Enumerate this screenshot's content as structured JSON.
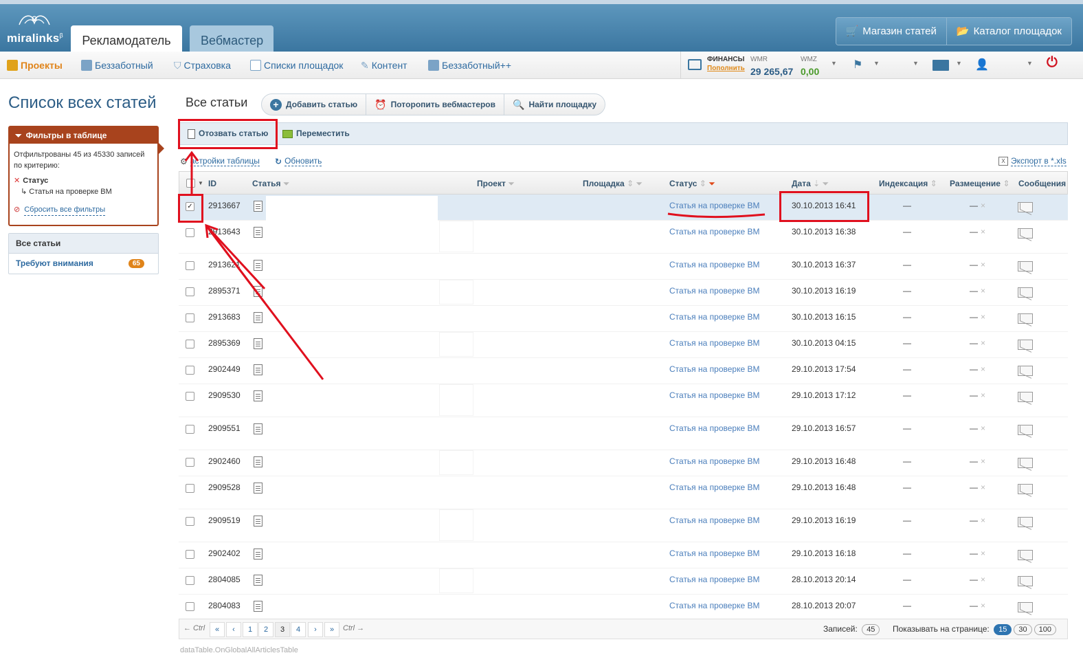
{
  "header": {
    "logo": "miralinks",
    "logo_sup": "β",
    "tabs": [
      {
        "label": "Рекламодатель",
        "active": true
      },
      {
        "label": "Вебмастер",
        "active": false
      }
    ],
    "shop_buttons": [
      "Магазин статей",
      "Каталог площадок"
    ]
  },
  "nav": {
    "items": [
      {
        "label": "Проекты",
        "icon": "projects-icon",
        "active": true
      },
      {
        "label": "Беззаботный",
        "icon": "users-icon"
      },
      {
        "label": "Страховка",
        "icon": "shield-icon"
      },
      {
        "label": "Списки площадок",
        "icon": "list-icon"
      },
      {
        "label": "Контент",
        "icon": "edit-icon"
      },
      {
        "label": "Беззаботный++",
        "icon": "users-icon"
      }
    ],
    "finance_label": "ФИНАНСЫ",
    "finance_link": "Пополнить",
    "wmr_label": "WMR",
    "wmr_value": "29 265,67",
    "wmz_label": "WMZ",
    "wmz_value": "0,00"
  },
  "sidebar": {
    "page_title": "Список всех статей",
    "filter_title": "Фильтры в таблице",
    "filter_summary": "Отфильтрованы 45 из 45330 записей по критерию:",
    "filter_criterion": "Статус",
    "filter_value": "Статья на проверке ВМ",
    "filter_reset": "Сбросить все фильтры",
    "list": [
      {
        "label": "Все статьи"
      },
      {
        "label": "Требуют внимания",
        "badge": "65"
      }
    ]
  },
  "main": {
    "section_title": "Все статьи",
    "actions": [
      "Добавить статью",
      "Потoропить вебмастеров",
      "Найти площадку"
    ],
    "toolbar": [
      "Отозвать статью",
      "Переместить"
    ],
    "settings_link": "астройки таблицы",
    "refresh_link": "Обновить",
    "export_link": "Экспорт в *.xls"
  },
  "table": {
    "headers": [
      "ID",
      "Статья",
      "Проект",
      "Площадка",
      "Статус",
      "Дата",
      "Индексация",
      "Размещение",
      "Сообщения"
    ],
    "rows": [
      {
        "id": "2913667",
        "status": "Статья на проверке ВМ",
        "date": "30.10.2013 16:41",
        "checked": true
      },
      {
        "id": "2913643",
        "status": "Статья на проверке ВМ",
        "date": "30.10.2013 16:38"
      },
      {
        "id": "2913621",
        "status": "Статья на проверке ВМ",
        "date": "30.10.2013 16:37"
      },
      {
        "id": "2895371",
        "status": "Статья на проверке ВМ",
        "date": "30.10.2013 16:19"
      },
      {
        "id": "2913683",
        "status": "Статья на проверке ВМ",
        "date": "30.10.2013 16:15"
      },
      {
        "id": "2895369",
        "status": "Статья на проверке ВМ",
        "date": "30.10.2013 04:15"
      },
      {
        "id": "2902449",
        "status": "Статья на проверке ВМ",
        "date": "29.10.2013 17:54"
      },
      {
        "id": "2909530",
        "status": "Статья на проверке ВМ",
        "date": "29.10.2013 17:12"
      },
      {
        "id": "2909551",
        "status": "Статья на проверке ВМ",
        "date": "29.10.2013 16:57"
      },
      {
        "id": "2902460",
        "status": "Статья на проверке ВМ",
        "date": "29.10.2013 16:48"
      },
      {
        "id": "2909528",
        "status": "Статья на проверке ВМ",
        "date": "29.10.2013 16:48"
      },
      {
        "id": "2909519",
        "status": "Статья на проверке ВМ",
        "date": "29.10.2013 16:19"
      },
      {
        "id": "2902402",
        "status": "Статья на проверке ВМ",
        "date": "29.10.2013 16:18"
      },
      {
        "id": "2804085",
        "status": "Статья на проверке ВМ",
        "date": "28.10.2013 20:14"
      },
      {
        "id": "2804083",
        "status": "Статья на проверке ВМ",
        "date": "28.10.2013 20:07"
      }
    ],
    "dash": "—",
    "close_mark": "×"
  },
  "pager": {
    "prev_hint": "← Ctrl",
    "next_hint": "Ctrl →",
    "first": "«",
    "prev": "‹",
    "pages": [
      "1",
      "2",
      "3",
      "4"
    ],
    "current": "3",
    "next": "›",
    "last": "»",
    "records_label": "Записей:",
    "records_value": "45",
    "per_page_label": "Показывать на странице:",
    "per_page": [
      "15",
      "30",
      "100"
    ]
  },
  "footer_note": "dataTable.OnGlobalAllArticlesTable",
  "colors": {
    "accent": "#2c5d86",
    "filter": "#a8431d",
    "annotation": "#e0101e",
    "orange": "#e0841a"
  }
}
